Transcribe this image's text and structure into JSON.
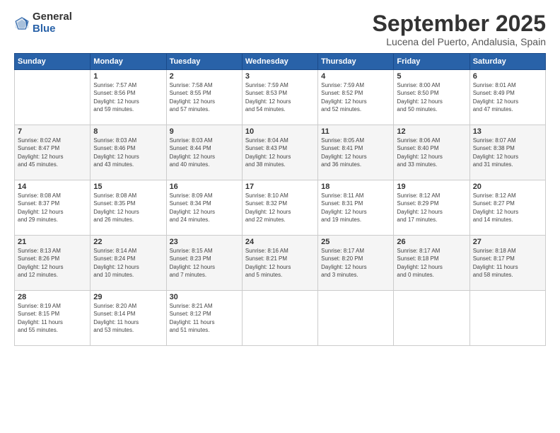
{
  "logo": {
    "general": "General",
    "blue": "Blue"
  },
  "title": "September 2025",
  "subtitle": "Lucena del Puerto, Andalusia, Spain",
  "weekdays": [
    "Sunday",
    "Monday",
    "Tuesday",
    "Wednesday",
    "Thursday",
    "Friday",
    "Saturday"
  ],
  "weeks": [
    [
      {
        "day": "",
        "detail": ""
      },
      {
        "day": "1",
        "detail": "Sunrise: 7:57 AM\nSunset: 8:56 PM\nDaylight: 12 hours\nand 59 minutes."
      },
      {
        "day": "2",
        "detail": "Sunrise: 7:58 AM\nSunset: 8:55 PM\nDaylight: 12 hours\nand 57 minutes."
      },
      {
        "day": "3",
        "detail": "Sunrise: 7:59 AM\nSunset: 8:53 PM\nDaylight: 12 hours\nand 54 minutes."
      },
      {
        "day": "4",
        "detail": "Sunrise: 7:59 AM\nSunset: 8:52 PM\nDaylight: 12 hours\nand 52 minutes."
      },
      {
        "day": "5",
        "detail": "Sunrise: 8:00 AM\nSunset: 8:50 PM\nDaylight: 12 hours\nand 50 minutes."
      },
      {
        "day": "6",
        "detail": "Sunrise: 8:01 AM\nSunset: 8:49 PM\nDaylight: 12 hours\nand 47 minutes."
      }
    ],
    [
      {
        "day": "7",
        "detail": "Sunrise: 8:02 AM\nSunset: 8:47 PM\nDaylight: 12 hours\nand 45 minutes."
      },
      {
        "day": "8",
        "detail": "Sunrise: 8:03 AM\nSunset: 8:46 PM\nDaylight: 12 hours\nand 43 minutes."
      },
      {
        "day": "9",
        "detail": "Sunrise: 8:03 AM\nSunset: 8:44 PM\nDaylight: 12 hours\nand 40 minutes."
      },
      {
        "day": "10",
        "detail": "Sunrise: 8:04 AM\nSunset: 8:43 PM\nDaylight: 12 hours\nand 38 minutes."
      },
      {
        "day": "11",
        "detail": "Sunrise: 8:05 AM\nSunset: 8:41 PM\nDaylight: 12 hours\nand 36 minutes."
      },
      {
        "day": "12",
        "detail": "Sunrise: 8:06 AM\nSunset: 8:40 PM\nDaylight: 12 hours\nand 33 minutes."
      },
      {
        "day": "13",
        "detail": "Sunrise: 8:07 AM\nSunset: 8:38 PM\nDaylight: 12 hours\nand 31 minutes."
      }
    ],
    [
      {
        "day": "14",
        "detail": "Sunrise: 8:08 AM\nSunset: 8:37 PM\nDaylight: 12 hours\nand 29 minutes."
      },
      {
        "day": "15",
        "detail": "Sunrise: 8:08 AM\nSunset: 8:35 PM\nDaylight: 12 hours\nand 26 minutes."
      },
      {
        "day": "16",
        "detail": "Sunrise: 8:09 AM\nSunset: 8:34 PM\nDaylight: 12 hours\nand 24 minutes."
      },
      {
        "day": "17",
        "detail": "Sunrise: 8:10 AM\nSunset: 8:32 PM\nDaylight: 12 hours\nand 22 minutes."
      },
      {
        "day": "18",
        "detail": "Sunrise: 8:11 AM\nSunset: 8:31 PM\nDaylight: 12 hours\nand 19 minutes."
      },
      {
        "day": "19",
        "detail": "Sunrise: 8:12 AM\nSunset: 8:29 PM\nDaylight: 12 hours\nand 17 minutes."
      },
      {
        "day": "20",
        "detail": "Sunrise: 8:12 AM\nSunset: 8:27 PM\nDaylight: 12 hours\nand 14 minutes."
      }
    ],
    [
      {
        "day": "21",
        "detail": "Sunrise: 8:13 AM\nSunset: 8:26 PM\nDaylight: 12 hours\nand 12 minutes."
      },
      {
        "day": "22",
        "detail": "Sunrise: 8:14 AM\nSunset: 8:24 PM\nDaylight: 12 hours\nand 10 minutes."
      },
      {
        "day": "23",
        "detail": "Sunrise: 8:15 AM\nSunset: 8:23 PM\nDaylight: 12 hours\nand 7 minutes."
      },
      {
        "day": "24",
        "detail": "Sunrise: 8:16 AM\nSunset: 8:21 PM\nDaylight: 12 hours\nand 5 minutes."
      },
      {
        "day": "25",
        "detail": "Sunrise: 8:17 AM\nSunset: 8:20 PM\nDaylight: 12 hours\nand 3 minutes."
      },
      {
        "day": "26",
        "detail": "Sunrise: 8:17 AM\nSunset: 8:18 PM\nDaylight: 12 hours\nand 0 minutes."
      },
      {
        "day": "27",
        "detail": "Sunrise: 8:18 AM\nSunset: 8:17 PM\nDaylight: 11 hours\nand 58 minutes."
      }
    ],
    [
      {
        "day": "28",
        "detail": "Sunrise: 8:19 AM\nSunset: 8:15 PM\nDaylight: 11 hours\nand 55 minutes."
      },
      {
        "day": "29",
        "detail": "Sunrise: 8:20 AM\nSunset: 8:14 PM\nDaylight: 11 hours\nand 53 minutes."
      },
      {
        "day": "30",
        "detail": "Sunrise: 8:21 AM\nSunset: 8:12 PM\nDaylight: 11 hours\nand 51 minutes."
      },
      {
        "day": "",
        "detail": ""
      },
      {
        "day": "",
        "detail": ""
      },
      {
        "day": "",
        "detail": ""
      },
      {
        "day": "",
        "detail": ""
      }
    ]
  ]
}
